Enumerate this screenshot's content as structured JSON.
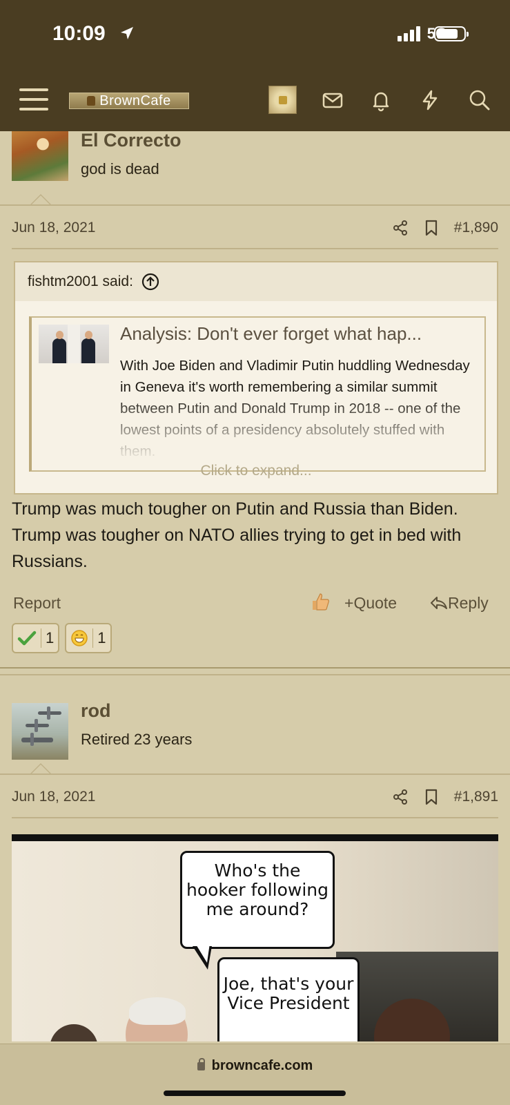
{
  "status_bar": {
    "time": "10:09",
    "network": "5G+"
  },
  "site": {
    "logo_text": "BrownCafe",
    "url": "browncafe.com"
  },
  "posts": [
    {
      "username": "El Correcto",
      "user_title": "god is dead",
      "date": "Jun 18, 2021",
      "post_number": "#1,890",
      "quote": {
        "author_line": "fishtm2001 said:",
        "embed_title": "Analysis: Don't ever forget what hap...",
        "embed_text": "With Joe Biden and Vladimir Putin huddling Wednesday in Geneva it's worth remembering a similar summit between Putin and Donald Trump in 2018 -- one of the lowest points of a presidency absolutely stuffed with them.",
        "expand_label": "Click to expand..."
      },
      "body": "Trump was much tougher on Putin and Russia than Biden. Trump was tougher on NATO allies trying to get in bed with Russians.",
      "actions": {
        "report": "Report",
        "quote": "Quote",
        "reply": "Reply"
      },
      "reactions": [
        {
          "icon": "checkmark-icon",
          "count": "1"
        },
        {
          "icon": "grin-emoji-icon",
          "count": "1"
        }
      ]
    },
    {
      "username": "rod",
      "user_title": "Retired 23 years",
      "date": "Jun 18, 2021",
      "post_number": "#1,891",
      "meme": {
        "bubble1": "Who's the hooker following me around?",
        "bubble2": "Joe, that's your Vice President"
      }
    }
  ],
  "colors": {
    "header": "#4a3d22",
    "page": "#d6ccaa",
    "accent": "#5a4e34"
  }
}
